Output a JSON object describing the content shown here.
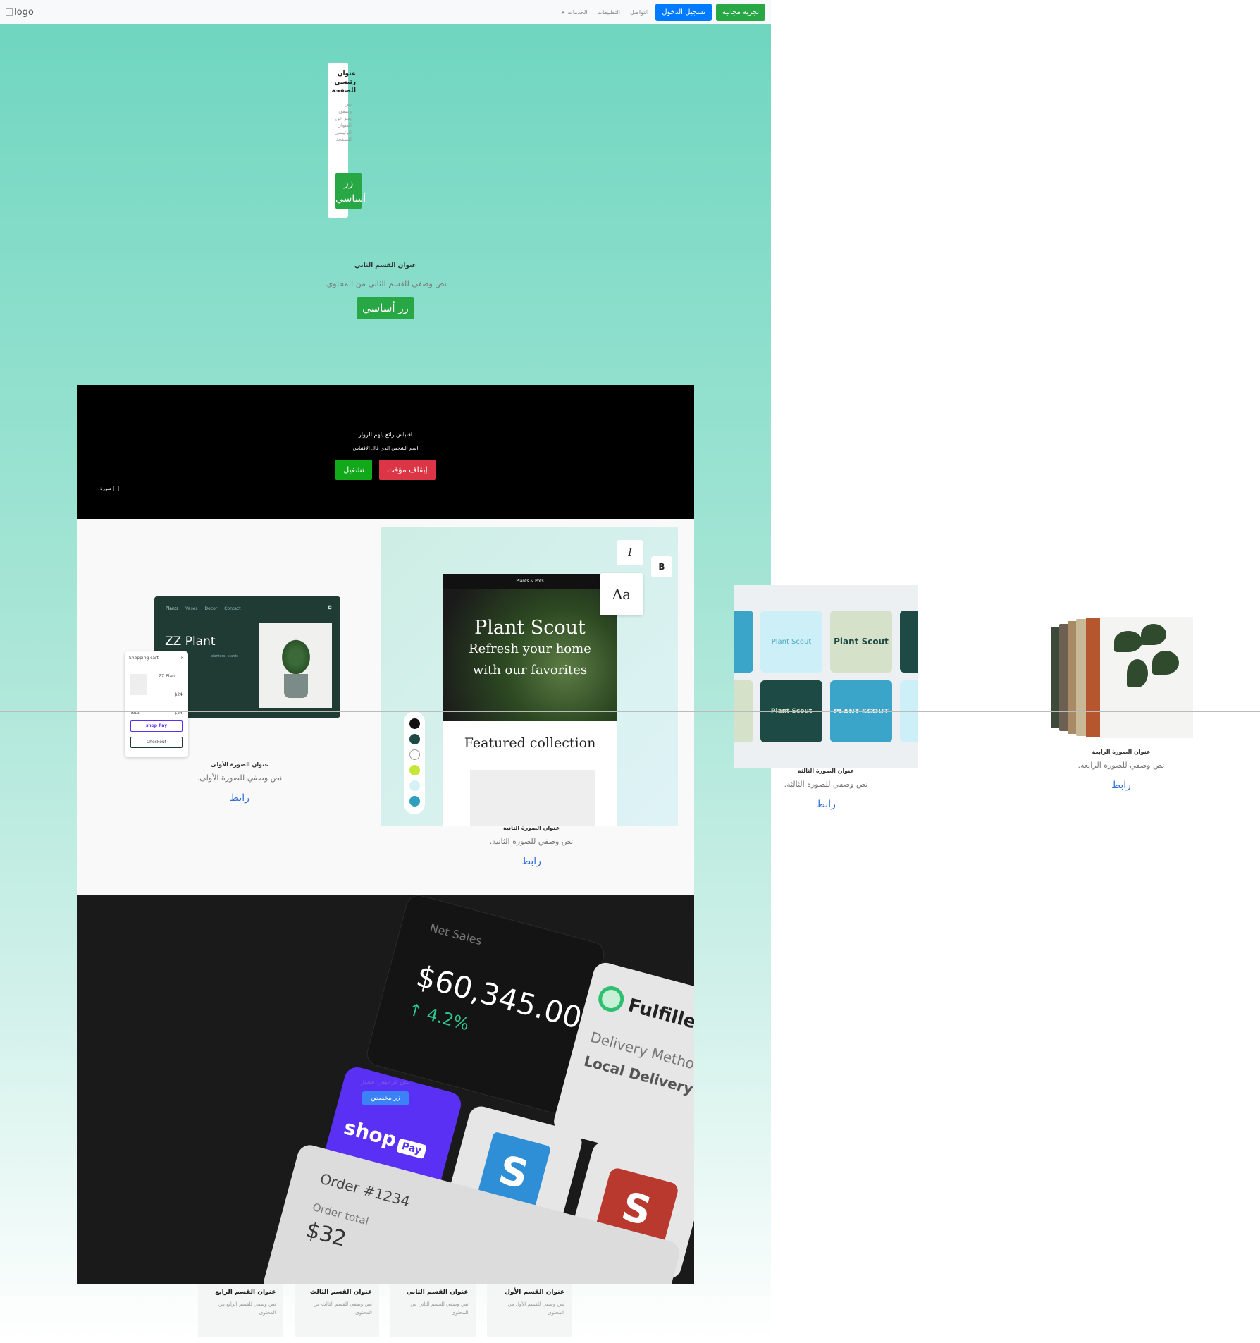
{
  "navbar": {
    "logo_alt": "logo",
    "trial_button": "تجربة مجانية",
    "login_button": "تسجيل الدخول",
    "links": [
      "التواصل",
      "التطبيقات",
      "الخدمات"
    ]
  },
  "hero": {
    "title": "عنوان رئيسي للصفحة",
    "description": "نص وصفي يعبر عن العنوان الرئيسي للصفحة",
    "button": "زر أساسي"
  },
  "section2": {
    "title": "عنوان القسم الثاني",
    "description": "نص وصفي للقسم الثاني من المحتوى.",
    "button": "زر أساسي"
  },
  "video": {
    "quote": "اقتباس رائع يلهم الزوار",
    "person": "اسم الشخص الذي قال الاقتباس",
    "play_button": "تشغيل",
    "pause_button": "إيقاف مؤقت",
    "image_alt": "صورة"
  },
  "cards": [
    {
      "title": "عنوان الصورة الأولى",
      "description": "نص وصفي للصورة الأولى.",
      "link": "رابط"
    },
    {
      "title": "عنوان الصورة الثانية",
      "description": "نص وصفي للصورة الثانية.",
      "link": "رابط"
    },
    {
      "title": "عنوان الصورة الثالثة",
      "description": "نص وصفي للصورة الثالثة.",
      "link": "رابط"
    },
    {
      "title": "عنوان الصورة الرابعة",
      "description": "نص وصفي للصورة الرابعة.",
      "link": "رابط"
    }
  ],
  "image1": {
    "nav": [
      "Plants",
      "Vases",
      "Decor",
      "Contact"
    ],
    "title": "ZZ Plant",
    "subtitle": "planters, plants",
    "cart_title": "Shopping cart",
    "cart_close": "×",
    "product": "ZZ Plant",
    "price": "$24",
    "total_label": "Total",
    "total_value": "$24",
    "shop_pay": "shop Pay",
    "checkout": "Checkout"
  },
  "image2": {
    "store": "Plants & Pots",
    "headline": "Plant Scout",
    "tagline_1": "Refresh your home",
    "tagline_2": "with our favorites",
    "featured": "Featured collection",
    "aa": "Aa",
    "italic": "I",
    "bold": "B",
    "swatch_colors": [
      "#111111",
      "#1d4a45",
      "#ffffff",
      "#c5e63a",
      "#d4f1f6",
      "#2e9fbf"
    ]
  },
  "image3": {
    "tiles": [
      "Plant Scout",
      "Plant Scout",
      "Plant Scout",
      "PLANT SCOUT"
    ]
  },
  "dashboard": {
    "net_sales_label": "Net Sales",
    "net_sales_value": "$60,345.00",
    "net_sales_change": "↑ 4.2%",
    "fulfilled": "Fulfilled",
    "delivery_method": "Delivery Method",
    "local_delivery": "Local Delivery",
    "shop_label": "shop",
    "pay_label": "Pay",
    "order": "Order #1234",
    "order_total": "Order total",
    "order_amount": "$32",
    "overlay_text": "نص ترحيبي مميز",
    "overlay_button": "زر مخصص"
  },
  "features": [
    {
      "title": "عنوان القسم الأول",
      "description": "نص وصفي للقسم الأول من المحتوى"
    },
    {
      "title": "عنوان القسم الثاني",
      "description": "نص وصفي للقسم الثاني من المحتوى"
    },
    {
      "title": "عنوان القسم الثالث",
      "description": "نص وصفي للقسم الثالث من المحتوى"
    },
    {
      "title": "عنوان القسم الرابع",
      "description": "نص وصفي للقسم الرابع من المحتوى"
    }
  ],
  "colors": {
    "primary_green": "#28a745",
    "primary_blue": "#007bff",
    "danger_red": "#dc3545",
    "link_blue": "#2f6fd6",
    "bg_mint": "#6dd5bf"
  }
}
